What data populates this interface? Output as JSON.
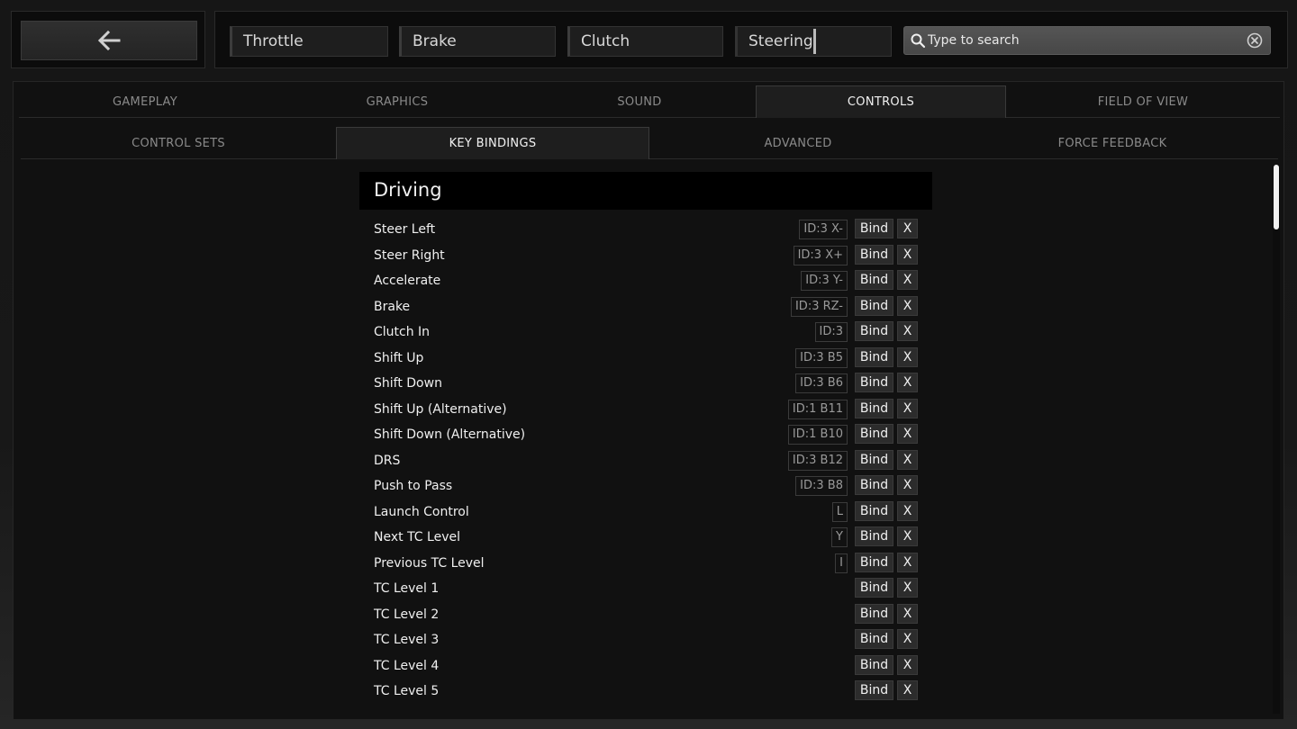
{
  "meters": [
    {
      "label": "Throttle"
    },
    {
      "label": "Brake"
    },
    {
      "label": "Clutch"
    },
    {
      "label": "Steering"
    }
  ],
  "search": {
    "placeholder": "Type to search"
  },
  "tabs": [
    "GAMEPLAY",
    "GRAPHICS",
    "SOUND",
    "CONTROLS",
    "FIELD OF VIEW"
  ],
  "active_tab": "CONTROLS",
  "subtabs": [
    "CONTROL SETS",
    "KEY BINDINGS",
    "ADVANCED",
    "FORCE FEEDBACK"
  ],
  "active_subtab": "KEY BINDINGS",
  "section": {
    "title": "Driving"
  },
  "bind_label": "Bind",
  "clear_label": "X",
  "bindings": [
    {
      "action": "Steer Left",
      "key": "ID:3 X-"
    },
    {
      "action": "Steer Right",
      "key": "ID:3 X+"
    },
    {
      "action": "Accelerate",
      "key": "ID:3 Y-"
    },
    {
      "action": "Brake",
      "key": "ID:3 RZ-"
    },
    {
      "action": "Clutch In",
      "key": "ID:3"
    },
    {
      "action": "Shift Up",
      "key": "ID:3 B5"
    },
    {
      "action": "Shift Down",
      "key": "ID:3 B6"
    },
    {
      "action": "Shift Up (Alternative)",
      "key": "ID:1 B11"
    },
    {
      "action": "Shift Down (Alternative)",
      "key": "ID:1 B10"
    },
    {
      "action": "DRS",
      "key": "ID:3 B12"
    },
    {
      "action": "Push to Pass",
      "key": "ID:3 B8"
    },
    {
      "action": "Launch Control",
      "key": "L"
    },
    {
      "action": "Next TC Level",
      "key": "Y"
    },
    {
      "action": "Previous TC Level",
      "key": "I"
    },
    {
      "action": "TC Level 1",
      "key": ""
    },
    {
      "action": "TC Level 2",
      "key": ""
    },
    {
      "action": "TC Level 3",
      "key": ""
    },
    {
      "action": "TC Level 4",
      "key": ""
    },
    {
      "action": "TC Level 5",
      "key": ""
    }
  ]
}
